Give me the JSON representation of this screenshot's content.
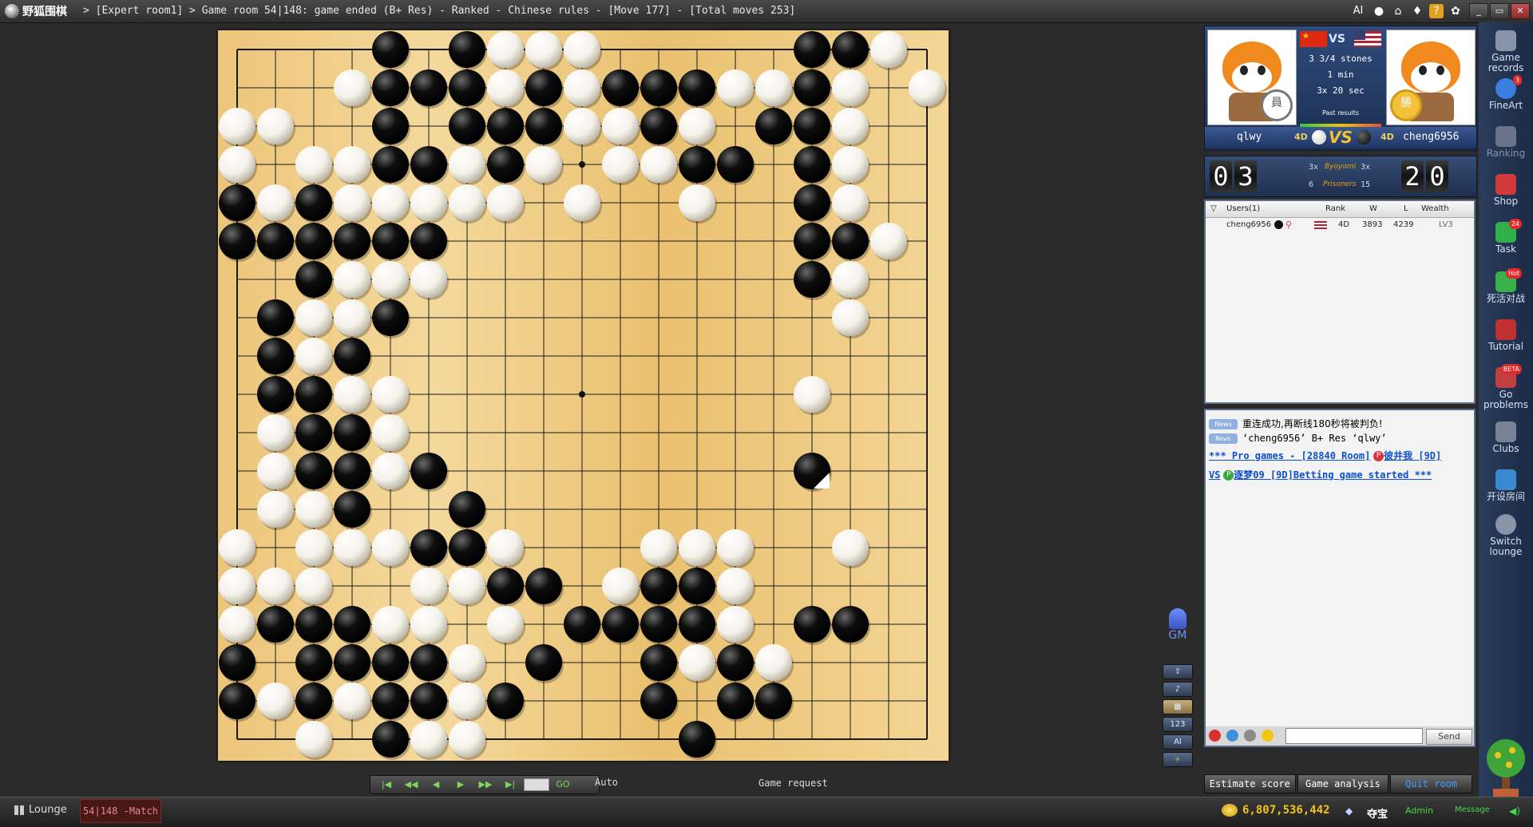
{
  "titlebar": {
    "app_name": "野狐围棋",
    "title": "> [Expert room1] > Game room 54|148: game ended (B+ Res) - Ranked - Chinese rules - [Move 177] - [Total moves 253]",
    "ai_label": "AI",
    "icons": [
      "user-icon",
      "home-icon",
      "shirt-icon",
      "help-icon",
      "gear-icon"
    ]
  },
  "board": {
    "size": 19,
    "grid_color": "#1a1a1a",
    "black_stones": [
      [
        4,
        0
      ],
      [
        6,
        0
      ],
      [
        15,
        0
      ],
      [
        16,
        0
      ],
      [
        4,
        1
      ],
      [
        5,
        1
      ],
      [
        6,
        1
      ],
      [
        8,
        1
      ],
      [
        10,
        1
      ],
      [
        11,
        1
      ],
      [
        12,
        1
      ],
      [
        15,
        1
      ],
      [
        4,
        2
      ],
      [
        6,
        2
      ],
      [
        7,
        2
      ],
      [
        8,
        2
      ],
      [
        11,
        2
      ],
      [
        14,
        2
      ],
      [
        15,
        2
      ],
      [
        4,
        3
      ],
      [
        5,
        3
      ],
      [
        7,
        3
      ],
      [
        12,
        3
      ],
      [
        13,
        3
      ],
      [
        15,
        3
      ],
      [
        0,
        4
      ],
      [
        2,
        4
      ],
      [
        15,
        4
      ],
      [
        0,
        5
      ],
      [
        1,
        5
      ],
      [
        2,
        5
      ],
      [
        3,
        5
      ],
      [
        4,
        5
      ],
      [
        5,
        5
      ],
      [
        15,
        5
      ],
      [
        16,
        5
      ],
      [
        2,
        6
      ],
      [
        15,
        6
      ],
      [
        1,
        7
      ],
      [
        4,
        7
      ],
      [
        1,
        8
      ],
      [
        3,
        8
      ],
      [
        1,
        9
      ],
      [
        2,
        9
      ],
      [
        2,
        10
      ],
      [
        3,
        10
      ],
      [
        2,
        11
      ],
      [
        3,
        11
      ],
      [
        5,
        11
      ],
      [
        15,
        11
      ],
      [
        3,
        12
      ],
      [
        6,
        12
      ],
      [
        5,
        13
      ],
      [
        6,
        13
      ],
      [
        7,
        14
      ],
      [
        8,
        14
      ],
      [
        11,
        14
      ],
      [
        12,
        14
      ],
      [
        1,
        15
      ],
      [
        2,
        15
      ],
      [
        3,
        15
      ],
      [
        9,
        15
      ],
      [
        10,
        15
      ],
      [
        11,
        15
      ],
      [
        12,
        15
      ],
      [
        15,
        15
      ],
      [
        16,
        15
      ],
      [
        0,
        16
      ],
      [
        2,
        16
      ],
      [
        3,
        16
      ],
      [
        4,
        16
      ],
      [
        5,
        16
      ],
      [
        8,
        16
      ],
      [
        11,
        16
      ],
      [
        13,
        16
      ],
      [
        0,
        17
      ],
      [
        2,
        17
      ],
      [
        4,
        17
      ],
      [
        5,
        17
      ],
      [
        7,
        17
      ],
      [
        11,
        17
      ],
      [
        13,
        17
      ],
      [
        14,
        17
      ],
      [
        4,
        18
      ],
      [
        12,
        18
      ]
    ],
    "white_stones": [
      [
        7,
        0
      ],
      [
        8,
        0
      ],
      [
        9,
        0
      ],
      [
        17,
        0
      ],
      [
        3,
        1
      ],
      [
        7,
        1
      ],
      [
        9,
        1
      ],
      [
        13,
        1
      ],
      [
        14,
        1
      ],
      [
        16,
        1
      ],
      [
        18,
        1
      ],
      [
        0,
        2
      ],
      [
        1,
        2
      ],
      [
        9,
        2
      ],
      [
        10,
        2
      ],
      [
        12,
        2
      ],
      [
        16,
        2
      ],
      [
        0,
        3
      ],
      [
        2,
        3
      ],
      [
        3,
        3
      ],
      [
        6,
        3
      ],
      [
        8,
        3
      ],
      [
        10,
        3
      ],
      [
        11,
        3
      ],
      [
        16,
        3
      ],
      [
        1,
        4
      ],
      [
        3,
        4
      ],
      [
        4,
        4
      ],
      [
        5,
        4
      ],
      [
        6,
        4
      ],
      [
        7,
        4
      ],
      [
        9,
        4
      ],
      [
        12,
        4
      ],
      [
        16,
        4
      ],
      [
        17,
        5
      ],
      [
        3,
        6
      ],
      [
        4,
        6
      ],
      [
        5,
        6
      ],
      [
        16,
        6
      ],
      [
        2,
        7
      ],
      [
        3,
        7
      ],
      [
        16,
        7
      ],
      [
        2,
        8
      ],
      [
        3,
        9
      ],
      [
        4,
        9
      ],
      [
        15,
        9
      ],
      [
        1,
        10
      ],
      [
        4,
        10
      ],
      [
        1,
        11
      ],
      [
        4,
        11
      ],
      [
        1,
        12
      ],
      [
        2,
        12
      ],
      [
        0,
        13
      ],
      [
        2,
        13
      ],
      [
        3,
        13
      ],
      [
        4,
        13
      ],
      [
        7,
        13
      ],
      [
        11,
        13
      ],
      [
        12,
        13
      ],
      [
        13,
        13
      ],
      [
        16,
        13
      ],
      [
        0,
        14
      ],
      [
        1,
        14
      ],
      [
        2,
        14
      ],
      [
        5,
        14
      ],
      [
        6,
        14
      ],
      [
        10,
        14
      ],
      [
        13,
        14
      ],
      [
        0,
        15
      ],
      [
        4,
        15
      ],
      [
        5,
        15
      ],
      [
        7,
        15
      ],
      [
        13,
        15
      ],
      [
        6,
        16
      ],
      [
        12,
        16
      ],
      [
        14,
        16
      ],
      [
        1,
        17
      ],
      [
        3,
        17
      ],
      [
        6,
        17
      ],
      [
        2,
        18
      ],
      [
        5,
        18
      ],
      [
        6,
        18
      ]
    ],
    "last_move": [
      15,
      11
    ],
    "hoshi": [
      [
        3,
        3
      ],
      [
        9,
        3
      ],
      [
        15,
        3
      ],
      [
        3,
        9
      ],
      [
        9,
        9
      ],
      [
        15,
        9
      ],
      [
        3,
        15
      ],
      [
        9,
        15
      ],
      [
        15,
        15
      ]
    ]
  },
  "side_tools": {
    "gm_label": "GM",
    "counter_label": "123",
    "ai_label": "AI",
    "plus_label": "+"
  },
  "navbar": {
    "buttons": [
      "|◀",
      "◀◀",
      "◀",
      "▶",
      "▶▶",
      "▶|"
    ],
    "go_label": "GO",
    "auto_label": "Auto",
    "game_request": "Game request"
  },
  "players": {
    "white_name": "qlwy",
    "white_rank": "4D",
    "black_name": "cheng6956",
    "black_rank": "4D",
    "vs": "VS",
    "komi": "3 3/4 stones",
    "main_time": "1 min",
    "byoyomi": "3x 20 sec",
    "past_results": "Past results",
    "white_badge": "員",
    "black_badge": "勝"
  },
  "score": {
    "white_digits": [
      "0",
      "3"
    ],
    "black_digits": [
      "2",
      "0"
    ],
    "byoyomi_label": "Byoyomi",
    "white_byoyomi": "3x",
    "black_byoyomi": "3x",
    "prisoners_label": "Prisoners",
    "white_prisoners": "6",
    "black_prisoners": "15"
  },
  "users": {
    "headers": [
      "Users(1)",
      "Rank",
      "W",
      "L",
      "Wealth"
    ],
    "rows": [
      {
        "name": "cheng6956",
        "rank": "4D",
        "w": "3893",
        "l": "4239",
        "wealth": "LV3"
      }
    ]
  },
  "chat": {
    "news_tag": "News",
    "line1": "重连成功,再断线180秒将被判负!",
    "line2": "‘cheng6956’ B+ Res ‘qlwy’",
    "pro_line": "*** Pro games - [28840 Room]",
    "pro_player": "彼井我 [9D]",
    "vs_label": "VS",
    "vs_player": "逐梦09 [9D]Betting game started ***",
    "send_label": "Send"
  },
  "bottom_buttons": [
    "Estimate score",
    "Game analysis",
    "Quit room"
  ],
  "rightbar": [
    {
      "label": "Game records",
      "badge": ""
    },
    {
      "label": "FineArt",
      "badge": "3"
    },
    {
      "label": "Ranking",
      "badge": ""
    },
    {
      "label": "Shop",
      "badge": ""
    },
    {
      "label": "Task",
      "badge": "24"
    },
    {
      "label": "死活对战",
      "badge": "Hot"
    },
    {
      "label": "Tutorial",
      "badge": ""
    },
    {
      "label": "Go problems",
      "badge": "BETA"
    },
    {
      "label": "Clubs",
      "badge": ""
    },
    {
      "label": "开设房间",
      "badge": ""
    },
    {
      "label": "Switch lounge",
      "badge": ""
    }
  ],
  "statusbar": {
    "lounge": "Lounge",
    "match_tab": "54|148 -Match",
    "coins": "6,807,536,442",
    "treasure": "夺宝",
    "admin": "Admin",
    "message": "Message"
  },
  "colors": {
    "black_stone": "#0d0d0d",
    "white_stone": "#f4f1e8",
    "board": "#f0cd86",
    "link": "#0b4fd0"
  }
}
